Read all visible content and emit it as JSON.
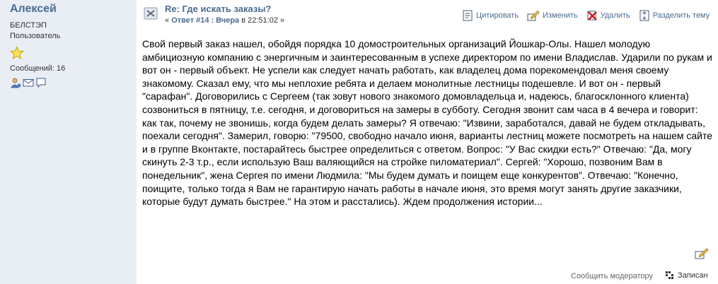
{
  "user": {
    "name": "Алексей",
    "group": "БЕЛСТЭП",
    "role": "Пользователь",
    "posts_label": "Сообщений: 16",
    "icons": [
      "profile-icon",
      "email-icon",
      "message-icon"
    ]
  },
  "post": {
    "title": "Re: Где искать заказы?",
    "meta_prefix": "« ",
    "meta_answer": "Ответ #14 : Вчера",
    "meta_time": " в 22:51:02 »",
    "actions": {
      "quote": "Цитировать",
      "edit": "Изменить",
      "delete": "Удалить",
      "split": "Разделить тему"
    },
    "body": "Свой первый заказ нашел, обойдя порядка 10 домостроительных организаций Йошкар-Олы. Нашел молодую амбициозную компанию с энергичным и заинтересованным в успехе директором по имени Владислав. Ударили по рукам и вот он - первый объект. Не успели как следует начать работать, как владелец дома порекомендовал меня своему знакомому. Сказал ему, что мы неплохие ребята и делаем монолитные лестницы подешевле. И вот он - первый \"сарафан\". Договорились с Сергеем (так зовут нового знакомого домовладельца и, надеюсь, благосклонного клиента) созвониться в пятницу, т.е. сегодня, и договориться на замеры в субботу. Сегодня звонит сам часа в 4 вечера и говорит: как так, почему не звонишь, когда будем делать замеры? Я отвечаю: \"Извини, заработался, давай не будем откладывать, поехали сегодня\". Замерил, говорю: \"79500, свободно начало июня, варианты лестниц можете посмотреть на нашем сайте и в группе Вконтакте, постарайтесь быстрее определиться с ответом. Вопрос: \"У Вас скидки есть?\" Отвечаю: \"Да, могу скинуть 2-3 т.р., если использую Ваш валяющийся на стройке пиломатериал\". Сергей: \"Хорошо, позвоним Вам в понедельник\", жена Сергея по имени Людмила: \"Мы будем думать и поищем еще конкурентов\". Отвечаю: \"Конечно, поищите, только тогда я Вам не гарантирую начать работы в начале июня, это время могут занять другие заказчики, которые будут думать быстрее.\" На этом и расстались). Ждем продолжения истории..."
  },
  "footer": {
    "report": "Сообщить модератору",
    "logged": "Записан"
  },
  "colors": {
    "sidebar_bg": "#e9eef5",
    "link": "#4a6b8f"
  }
}
